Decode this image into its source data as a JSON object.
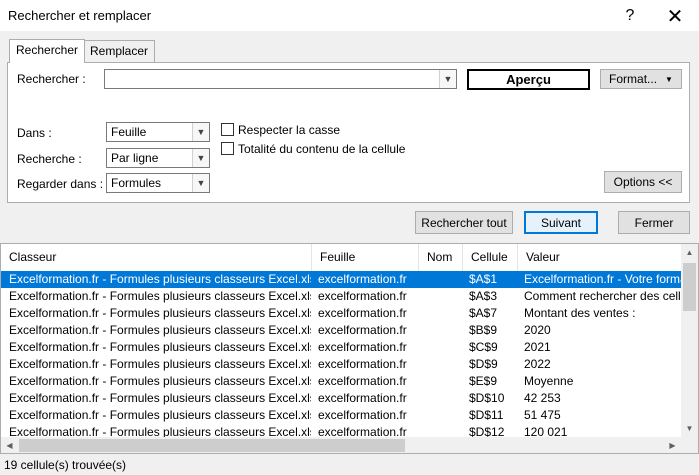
{
  "window": {
    "title": "Rechercher et remplacer",
    "help_glyph": "?",
    "close_glyph": "✕"
  },
  "tabs": [
    {
      "label": "Rechercher",
      "active": true
    },
    {
      "label": "Remplacer",
      "active": false
    }
  ],
  "search": {
    "label": "Rechercher :",
    "value": "",
    "preview_label": "Aperçu",
    "format_label": "Format..."
  },
  "options": {
    "within_label": "Dans :",
    "within_value": "Feuille",
    "search_label": "Recherche :",
    "search_value": "Par ligne",
    "lookin_label": "Regarder dans :",
    "lookin_value": "Formules",
    "match_case_label": "Respecter la casse",
    "match_case_checked": false,
    "entire_cell_label": "Totalité du contenu de la cellule",
    "entire_cell_checked": false,
    "options_button": "Options <<"
  },
  "actions": {
    "find_all": "Rechercher tout",
    "find_next": "Suivant",
    "close": "Fermer"
  },
  "results": {
    "columns": [
      "Classeur",
      "Feuille",
      "Nom",
      "Cellule",
      "Valeur"
    ],
    "rows": [
      [
        "Excelformation.fr - Formules plusieurs classeurs Excel.xlsx",
        "excelformation.fr",
        "",
        "$A$1",
        "Excelformation.fr - Votre forma"
      ],
      [
        "Excelformation.fr - Formules plusieurs classeurs Excel.xlsx",
        "excelformation.fr",
        "",
        "$A$3",
        "Comment rechercher des cellul"
      ],
      [
        "Excelformation.fr - Formules plusieurs classeurs Excel.xlsx",
        "excelformation.fr",
        "",
        "$A$7",
        "Montant des ventes :"
      ],
      [
        "Excelformation.fr - Formules plusieurs classeurs Excel.xlsx",
        "excelformation.fr",
        "",
        "$B$9",
        "2020"
      ],
      [
        "Excelformation.fr - Formules plusieurs classeurs Excel.xlsx",
        "excelformation.fr",
        "",
        "$C$9",
        "2021"
      ],
      [
        "Excelformation.fr - Formules plusieurs classeurs Excel.xlsx",
        "excelformation.fr",
        "",
        "$D$9",
        "2022"
      ],
      [
        "Excelformation.fr - Formules plusieurs classeurs Excel.xlsx",
        "excelformation.fr",
        "",
        "$E$9",
        "Moyenne"
      ],
      [
        "Excelformation.fr - Formules plusieurs classeurs Excel.xlsx",
        "excelformation.fr",
        "",
        "$D$10",
        "42 253"
      ],
      [
        "Excelformation.fr - Formules plusieurs classeurs Excel.xlsx",
        "excelformation.fr",
        "",
        "$D$11",
        "51 475"
      ],
      [
        "Excelformation.fr - Formules plusieurs classeurs Excel.xlsx",
        "excelformation.fr",
        "",
        "$D$12",
        "120 021"
      ]
    ],
    "selected_index": 0
  },
  "status": {
    "text": "19 cellule(s) trouvée(s)"
  },
  "colors": {
    "selection": "#0078d7",
    "default_button_border": "#0078d7"
  }
}
